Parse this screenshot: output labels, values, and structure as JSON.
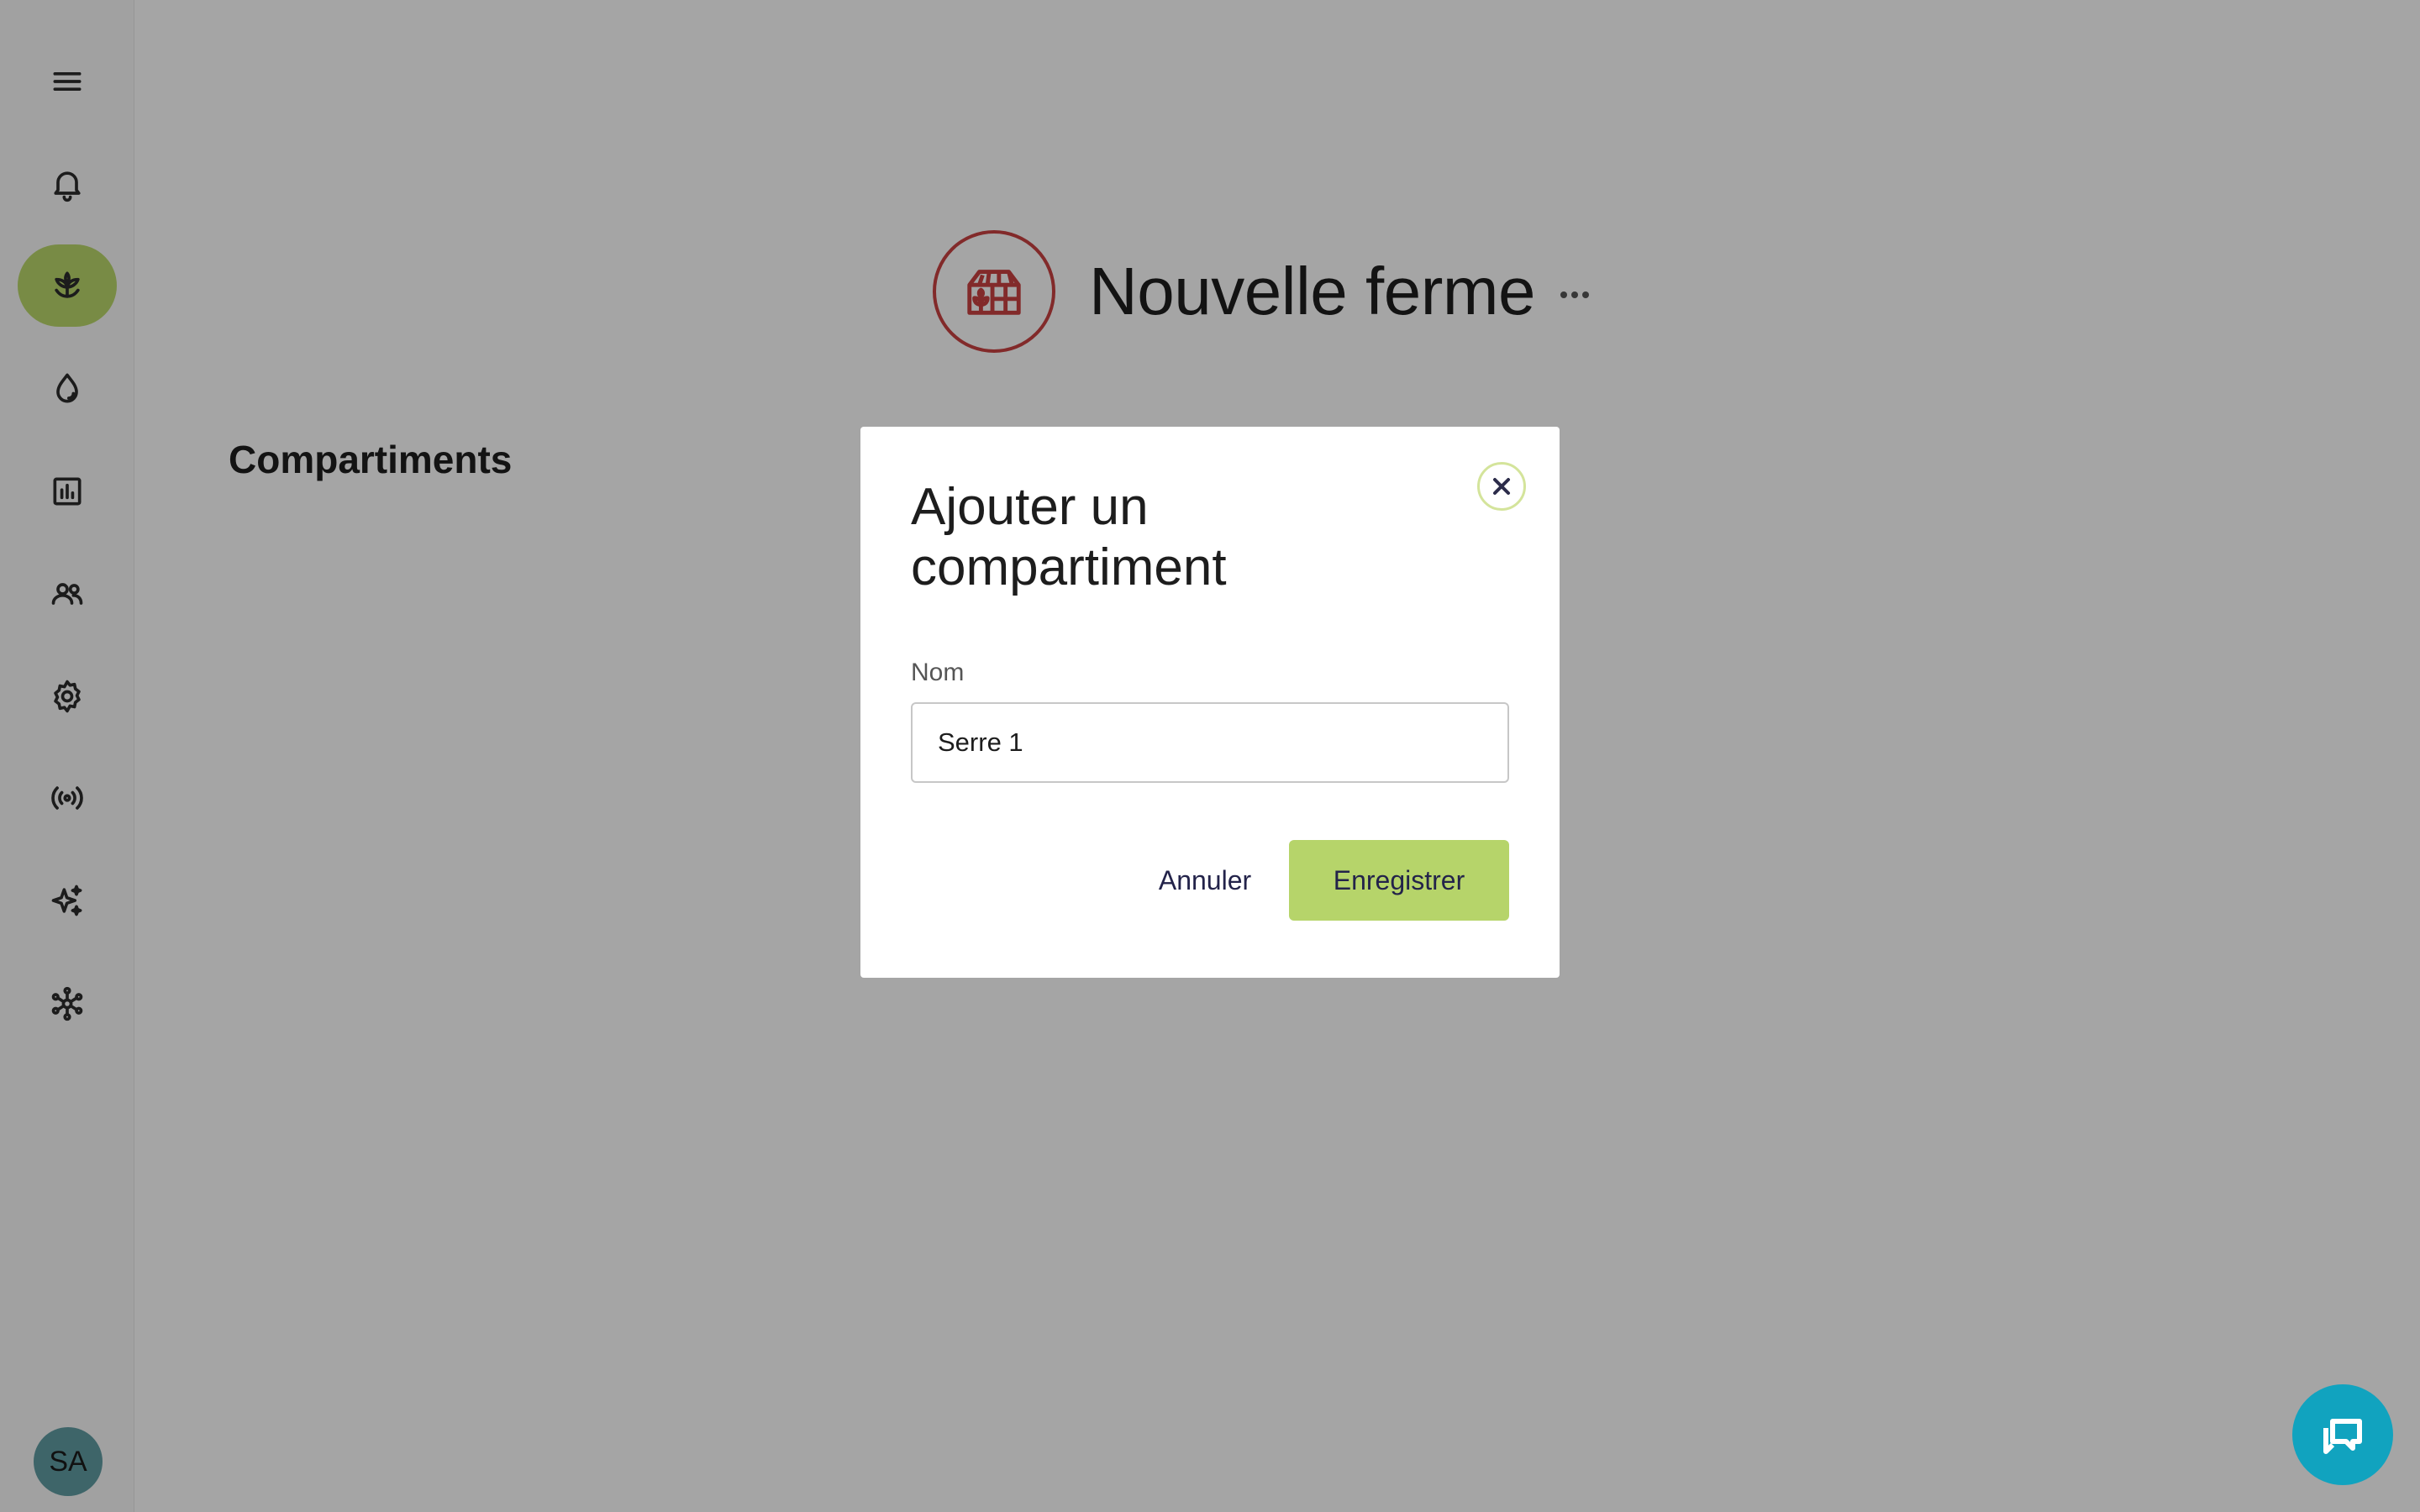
{
  "sidebar": {
    "items": [
      {
        "icon": "menu-icon"
      },
      {
        "icon": "bell-icon"
      },
      {
        "icon": "sprout-icon",
        "active": true
      },
      {
        "icon": "droplet-icon"
      },
      {
        "icon": "bar-chart-icon"
      },
      {
        "icon": "users-icon"
      },
      {
        "icon": "gear-icon"
      },
      {
        "icon": "broadcast-icon"
      },
      {
        "icon": "sparkles-icon"
      },
      {
        "icon": "network-icon"
      }
    ],
    "avatar_initials": "SA"
  },
  "farm": {
    "title": "Nouvelle ferme",
    "logo_icon": "greenhouse-icon"
  },
  "main": {
    "section_title": "Compartiments"
  },
  "dialog": {
    "title": "Ajouter un compartiment",
    "field_label": "Nom",
    "field_value": "Serre 1",
    "cancel_label": "Annuler",
    "save_label": "Enregistrer"
  },
  "colors": {
    "accent": "#b6d46a",
    "logo": "#c64040",
    "chat": "#11a3bf"
  }
}
